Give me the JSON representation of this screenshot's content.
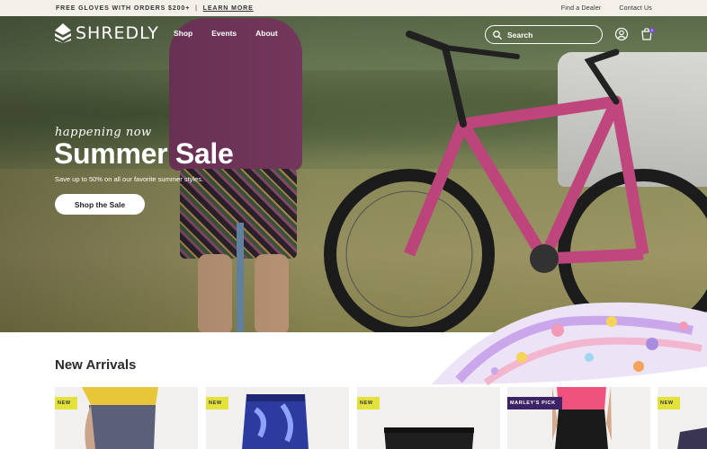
{
  "announcement": {
    "promo_text": "FREE GLOVES WITH ORDERS $200+",
    "separator": "|",
    "promo_link": "LEARN MORE",
    "links": [
      "Find a Dealer",
      "Contact Us"
    ]
  },
  "header": {
    "brand": "SHREDLY",
    "nav": [
      "Shop",
      "Events",
      "About"
    ],
    "search_placeholder": "Search",
    "cart_count": "0"
  },
  "hero": {
    "eyebrow": "happening now",
    "title": "Summer Sale",
    "subtitle": "Save up to 50% on all our favorite summer styles.",
    "cta": "Shop the Sale"
  },
  "new_arrivals": {
    "title": "New Arrivals",
    "products": [
      {
        "badge": "NEW"
      },
      {
        "badge": "NEW"
      },
      {
        "badge": "NEW"
      },
      {
        "badge": "MARLEY'S PICK"
      },
      {
        "badge": "NEW"
      }
    ]
  },
  "colors": {
    "announcement_bg": "#f3efe9",
    "badge_new": "#e3e23a",
    "badge_pick": "#3c2366",
    "cart_badge": "#7a4bd6",
    "bike_frame": "#c2477f"
  }
}
